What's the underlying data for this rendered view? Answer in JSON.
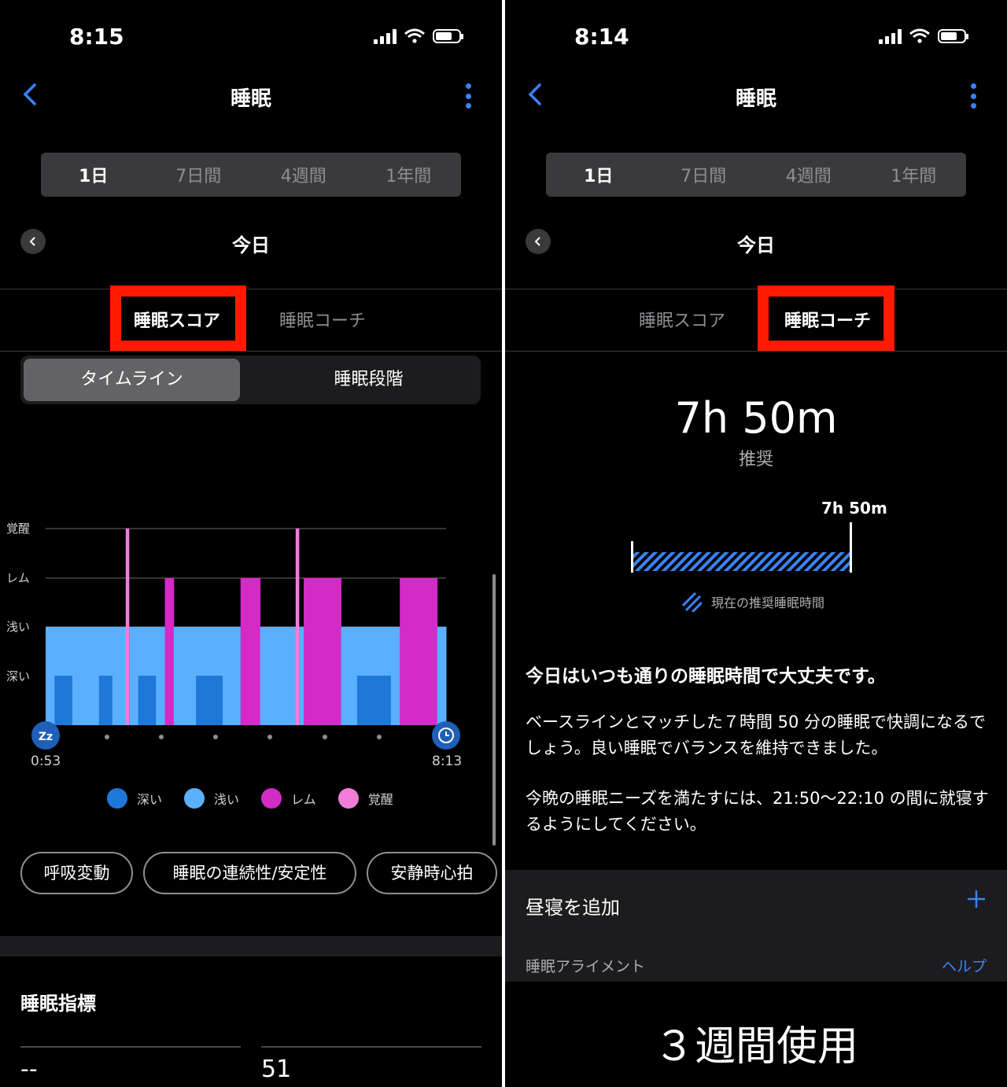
{
  "left": {
    "status": {
      "time": "8:15"
    },
    "nav": {
      "title": "睡眠"
    },
    "range_tabs": [
      "1日",
      "7日間",
      "4週間",
      "1年間"
    ],
    "date": "今日",
    "tabs": {
      "score": "睡眠スコア",
      "coach": "睡眠コーチ",
      "active": "score"
    },
    "view_toggle": {
      "timeline": "タイムライン",
      "stages": "睡眠段階"
    },
    "chart": {
      "ylabels": [
        "覚醒",
        "レム",
        "浅い",
        "深い"
      ],
      "start_time": "0:53",
      "end_time": "8:13"
    },
    "legend": [
      {
        "label": "深い",
        "color": "#1e78d8"
      },
      {
        "label": "浅い",
        "color": "#5ab0ff"
      },
      {
        "label": "レム",
        "color": "#d22bc6"
      },
      {
        "label": "覚醒",
        "color": "#f07ed8"
      }
    ],
    "pills": [
      "呼吸変動",
      "睡眠の連続性/安定性",
      "安静時心拍"
    ],
    "metrics": {
      "title": "睡眠指標",
      "value1": "--",
      "value2": "51"
    }
  },
  "right": {
    "status": {
      "time": "8:14"
    },
    "nav": {
      "title": "睡眠"
    },
    "range_tabs": [
      "1日",
      "7日間",
      "4週間",
      "1年間"
    ],
    "date": "今日",
    "tabs": {
      "score": "睡眠スコア",
      "coach": "睡眠コーチ",
      "active": "coach"
    },
    "recommended": {
      "duration": "7h 50m",
      "label": "推奨",
      "bar_label": "7h 50m",
      "legend": "現在の推奨睡眠時間"
    },
    "paragraphs": {
      "heading": "今日はいつも通りの睡眠時間で大丈夫です。",
      "p1": "ベースラインとマッチした７時間 50 分の睡眠で快調になるでしょう。良い睡眠でバランスを維持できました。",
      "p2": "今晩の睡眠ニーズを満たすには、21:50～22:10 の間に就寝するようにしてください。"
    },
    "nap": {
      "label": "昼寝を追加"
    },
    "alignment": {
      "label": "睡眠アライメント",
      "help": "ヘルプ"
    },
    "usage": "３週間使用"
  },
  "sleep_stages": [
    {
      "stage": "light",
      "dur": 1
    },
    {
      "stage": "deep",
      "dur": 2
    },
    {
      "stage": "light",
      "dur": 3
    },
    {
      "stage": "deep",
      "dur": 1.5
    },
    {
      "stage": "light",
      "dur": 1.5
    },
    {
      "stage": "awake",
      "dur": 0.4
    },
    {
      "stage": "light",
      "dur": 1
    },
    {
      "stage": "deep",
      "dur": 2
    },
    {
      "stage": "light",
      "dur": 1
    },
    {
      "stage": "rem",
      "dur": 1
    },
    {
      "stage": "light",
      "dur": 2.5
    },
    {
      "stage": "deep",
      "dur": 3
    },
    {
      "stage": "light",
      "dur": 2
    },
    {
      "stage": "rem",
      "dur": 2.2
    },
    {
      "stage": "light",
      "dur": 4
    },
    {
      "stage": "awake",
      "dur": 0.4
    },
    {
      "stage": "light",
      "dur": 0.5
    },
    {
      "stage": "rem",
      "dur": 4.2
    },
    {
      "stage": "light",
      "dur": 1.8
    },
    {
      "stage": "deep",
      "dur": 3.8
    },
    {
      "stage": "light",
      "dur": 1
    },
    {
      "stage": "rem",
      "dur": 4.2
    },
    {
      "stage": "light",
      "dur": 1
    }
  ]
}
